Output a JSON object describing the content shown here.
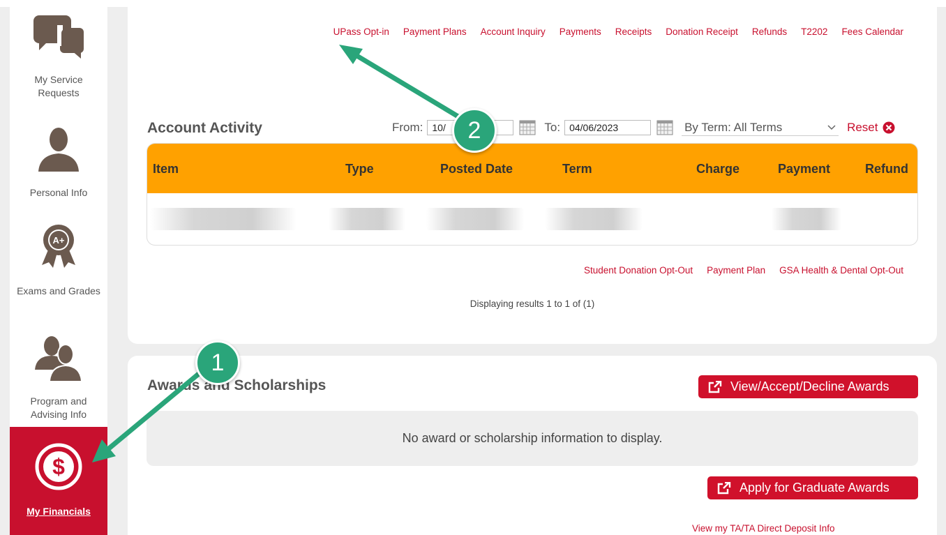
{
  "sidebar": {
    "items": [
      {
        "label": "My Service Requests",
        "icon": "chat-bubbles-icon"
      },
      {
        "label": "Personal Info",
        "icon": "person-icon"
      },
      {
        "label": "Exams and Grades",
        "icon": "award-ribbon-icon",
        "icon_text": "A+"
      },
      {
        "label": "Program and Advising Info",
        "icon": "people-icon"
      },
      {
        "label": "My Financials",
        "icon": "dollar-circle-icon",
        "active": true
      }
    ]
  },
  "top_links": [
    "UPass Opt-in",
    "Payment Plans",
    "Account Inquiry",
    "Payments",
    "Receipts",
    "Donation Receipt",
    "Refunds",
    "T2202",
    "Fees Calendar"
  ],
  "account_activity": {
    "title": "Account Activity",
    "from_label": "From:",
    "from_value": "10/",
    "to_label": "To:",
    "to_value": "04/06/2023",
    "term_label": "By Term:",
    "term_value": "All Terms",
    "reset_label": "Reset",
    "columns": [
      "Item",
      "Type",
      "Posted Date",
      "Term",
      "Charge",
      "Payment",
      "Refund"
    ]
  },
  "sub_links": [
    "Student Donation Opt-Out",
    "Payment Plan",
    "GSA Health & Dental Opt-Out"
  ],
  "results_text": "Displaying results 1 to 1 of (1)",
  "awards": {
    "title": "Awards and Scholarships",
    "view_button": "View/Accept/Decline Awards",
    "empty_text": "No award or scholarship information to display.",
    "apply_button": "Apply for Graduate Awards",
    "bottom_link": "View my TA/TA Direct Deposit Info"
  },
  "annotations": [
    "1",
    "2"
  ],
  "colors": {
    "accent": "#c8102e",
    "header": "#ffa100",
    "badge": "#2aa57a"
  }
}
